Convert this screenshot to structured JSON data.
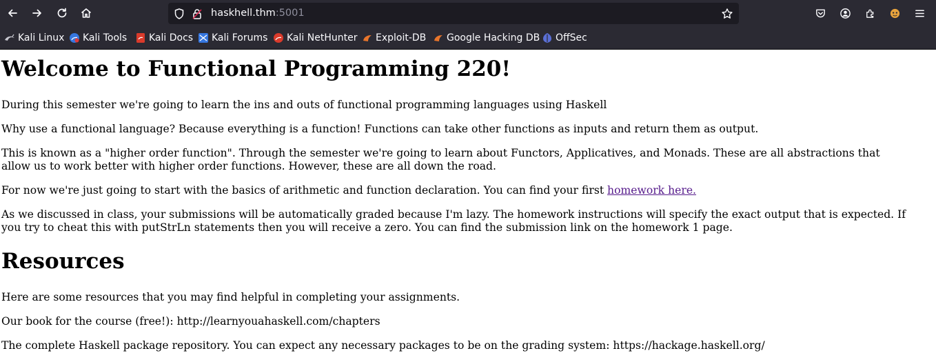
{
  "browser": {
    "url_host": "haskhell.thm",
    "url_port": ":5001",
    "bookmarks": [
      {
        "label": "Kali Linux",
        "icon": "kali-linux-icon"
      },
      {
        "label": "Kali Tools",
        "icon": "kali-tools-icon"
      },
      {
        "label": "Kali Docs",
        "icon": "kali-docs-icon"
      },
      {
        "label": "Kali Forums",
        "icon": "kali-forums-icon"
      },
      {
        "label": "Kali NetHunter",
        "icon": "kali-nethunter-icon"
      },
      {
        "label": "Exploit-DB",
        "icon": "exploit-db-icon"
      },
      {
        "label": "Google Hacking DB",
        "icon": "google-hacking-db-icon"
      },
      {
        "label": "OffSec",
        "icon": "offsec-icon"
      }
    ],
    "colors": {
      "chrome": "#2b2a33",
      "urlbar": "#1c1b22",
      "text": "#fbfbfe",
      "link_visited": "#551a8b"
    }
  },
  "page": {
    "title": "Welcome to Functional Programming 220!",
    "intro": "During this semester we're going to learn the ins and outs of functional programming languages using Haskell",
    "why": "Why use a functional language? Because everything is a function! Functions can take other functions as inputs and return them as output.",
    "higher_order_line1": "This is known as a \"higher order function\". Through the semester we're going to learn about Functors, Applicatives, and Monads. These are all abstractions that",
    "higher_order_line2": "allow us to work better with higher order functions. However, these are all down the road.",
    "homework_text": "For now we're just going to start with the basics of arithmetic and function declaration. You can find your first ",
    "homework_link": "homework here.",
    "grading_line1": "As we discussed in class, your submissions will be automatically graded because I'm lazy. The homework instructions will specify the exact output that is expected. If",
    "grading_line2": "you try to cheat this with putStrLn statements then you will receive a zero. You can find the submission link on the homework 1 page.",
    "resources_heading": "Resources",
    "resources_intro": "Here are some resources that you may find helpful in completing your assignments.",
    "book": "Our book for the course (free!): http://learnyouahaskell.com/chapters",
    "hackage": "The complete Haskell package repository. You can expect any necessary packages to be on the grading system: https://hackage.haskell.org/"
  }
}
